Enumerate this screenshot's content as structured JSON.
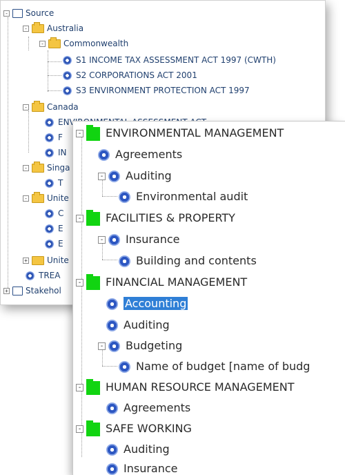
{
  "back_tree": {
    "source": "Source",
    "australia": "Australia",
    "commonwealth": "Commonwealth",
    "s1": "S1  INCOME TAX ASSESSMENT ACT 1997 (CWTH)",
    "s2": "S2  CORPORATIONS ACT 2001",
    "s3": "S3 ENVIRONMENT PROTECTION ACT 1997",
    "canada": "Canada",
    "env_assessment": "ENVIRONMENTAL ASSESSMENT ACT",
    "f_item": "F",
    "in_item": "IN",
    "singa": "Singa",
    "t_item": "T",
    "unite1": "Unite",
    "c_item": "C",
    "e_item1": "E",
    "e_item2": "E",
    "unite2": "Unite",
    "trea": "TREA",
    "stakehol": "Stakehol"
  },
  "front_tree": {
    "env_mgmt": "ENVIRONMENTAL MANAGEMENT",
    "agreements1": "Agreements",
    "auditing1": "Auditing",
    "env_audit": "Environmental audit",
    "facilities": "FACILITIES & PROPERTY",
    "insurance1": "Insurance",
    "building": "Building and contents",
    "financial": "FINANCIAL MANAGEMENT",
    "accounting": "Accounting",
    "auditing2": "Auditing",
    "budgeting": "Budgeting",
    "budget_name": "Name of budget [name of budg",
    "hr": "HUMAN RESOURCE MANAGEMENT",
    "agreements2": "Agreements",
    "safe": "SAFE WORKING",
    "auditing3": "Auditing",
    "insurance2": "Insurance"
  },
  "colors": {
    "selection": "#2f7fd6",
    "folder_green": "#11d411",
    "folder_yellow": "#f4c542"
  }
}
